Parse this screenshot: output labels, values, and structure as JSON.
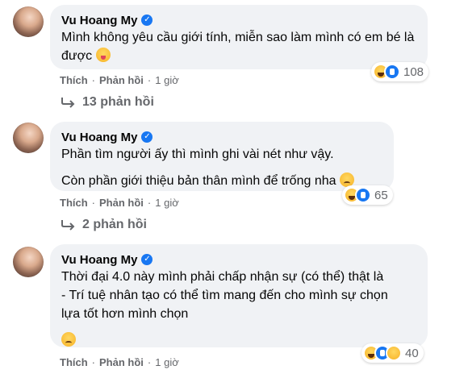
{
  "comments": [
    {
      "author": "Vu Hoang My",
      "lines": [
        "Mình không yêu cầu giới tính, miễn sao làm mình có em bé là được"
      ],
      "emoji": "grinning-squinting-tongue-emoji",
      "reactions": {
        "count": "108",
        "icons": [
          "haha",
          "like"
        ]
      },
      "actions": {
        "like": "Thích",
        "reply": "Phản hồi",
        "time": "1 giờ"
      },
      "replies": "13 phản hồi"
    },
    {
      "author": "Vu Hoang My",
      "lines": [
        "Phần tìm người ấy thì mình ghi vài nét như vậy.",
        "Còn phần giới thiệu bản thân mình để trống nha"
      ],
      "emoji": "sad-emoji",
      "reactions": {
        "count": "65",
        "icons": [
          "haha",
          "like"
        ]
      },
      "actions": {
        "like": "Thích",
        "reply": "Phản hồi",
        "time": "1 giờ"
      },
      "replies": "2 phản hồi"
    },
    {
      "author": "Vu Hoang My",
      "lines": [
        "Thời đại 4.0 này mình phải chấp nhận sự (có thể) thật là",
        "- Trí tuệ nhân tạo có thể tìm mang đến cho mình sự chọn",
        "lựa tốt hơn mình chọn"
      ],
      "emoji": "crying-emoji",
      "reactions": {
        "count": "40",
        "icons": [
          "haha",
          "like",
          "sad"
        ]
      },
      "actions": {
        "like": "Thích",
        "reply": "Phản hồi",
        "time": "1 giờ"
      }
    }
  ],
  "colors": {
    "bubble": "#f0f2f5",
    "accent": "#1877f2",
    "secondary_text": "#65676b"
  }
}
